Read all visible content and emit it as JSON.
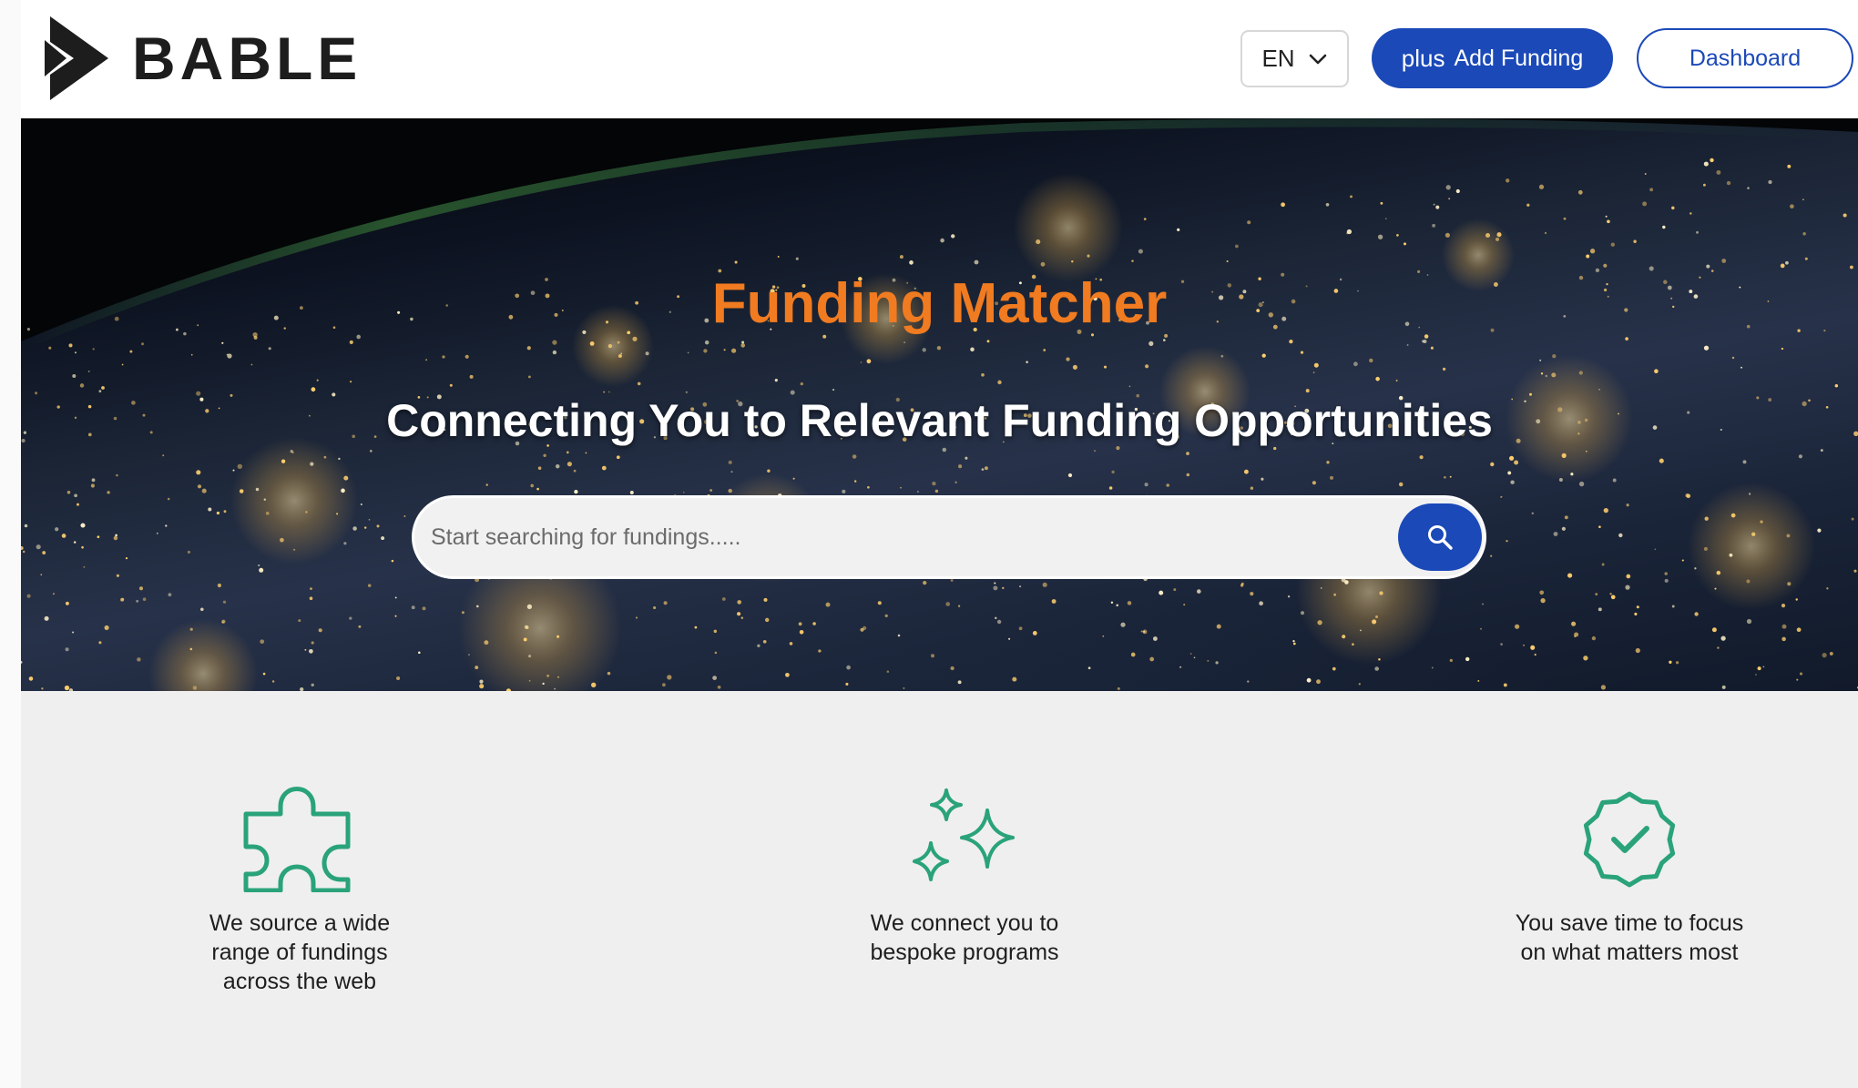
{
  "brand": {
    "logo_text": "BABLE",
    "logo_icon": "play-arrow-logo-icon"
  },
  "header": {
    "language": "EN",
    "add_funding_icon": "plus",
    "add_funding_label": "Add Funding",
    "dashboard_label": "Dashboard"
  },
  "hero": {
    "title": "Funding Matcher",
    "subtitle": "Connecting You to Relevant Funding Opportunities",
    "search": {
      "placeholder": "Start searching for fundings.....",
      "value": "",
      "button_icon": "search-icon"
    }
  },
  "features": [
    {
      "icon": "puzzle-icon",
      "text_lines": [
        "We source a wide",
        "range of fundings",
        "across the web"
      ]
    },
    {
      "icon": "sparkles-icon",
      "text_lines": [
        "We connect you to",
        "bespoke programs"
      ]
    },
    {
      "icon": "verified-badge-icon",
      "text_lines": [
        "You save time to focus",
        "on what matters most"
      ]
    }
  ],
  "colors": {
    "primary_blue": "#1b49b8",
    "title_orange": "#f07b20",
    "icon_green": "#2aa37a",
    "section_bg": "#efefef"
  }
}
